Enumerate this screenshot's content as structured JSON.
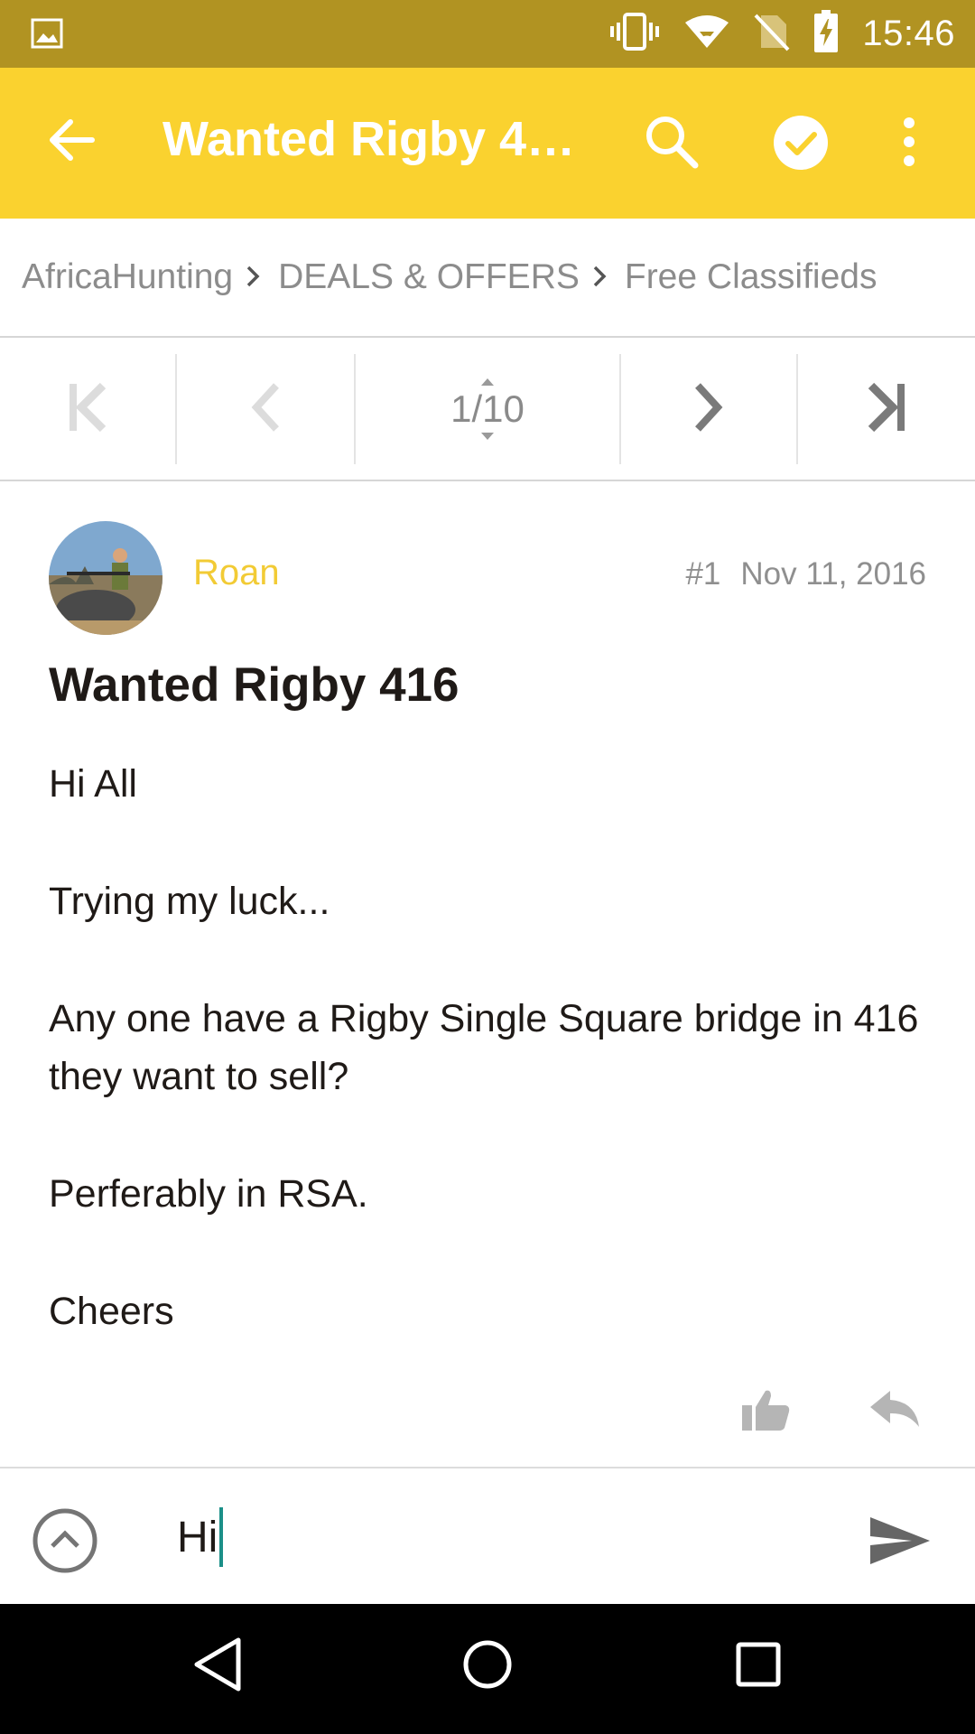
{
  "status_bar": {
    "time": "15:46",
    "icons": [
      "gallery-icon",
      "vibrate-icon",
      "wifi-icon",
      "no-sim-icon",
      "battery-charging-icon"
    ]
  },
  "app_bar": {
    "title": "Wanted Rigby 4…",
    "icons": [
      "back-arrow-icon",
      "search-icon",
      "check-circle-icon",
      "more-vert-icon"
    ]
  },
  "breadcrumb": {
    "items": [
      "AfricaHunting",
      "DEALS & OFFERS",
      "Free Classifieds"
    ]
  },
  "pagination": {
    "page_label": "1/10"
  },
  "post": {
    "author": "Roan",
    "number": "#1",
    "date": "Nov 11, 2016",
    "title": "Wanted Rigby 416",
    "paragraphs": [
      "Hi All",
      "Trying my luck...",
      "Any one have a Rigby Single Square bridge in 416 they want to sell?",
      "Perferably in RSA.",
      "Cheers"
    ]
  },
  "reply_bar": {
    "value": "Hi"
  },
  "colors": {
    "status_bar": "#b19322",
    "app_bar": "#fad22f",
    "author": "#f2cb35",
    "caret": "#1b8f88"
  }
}
